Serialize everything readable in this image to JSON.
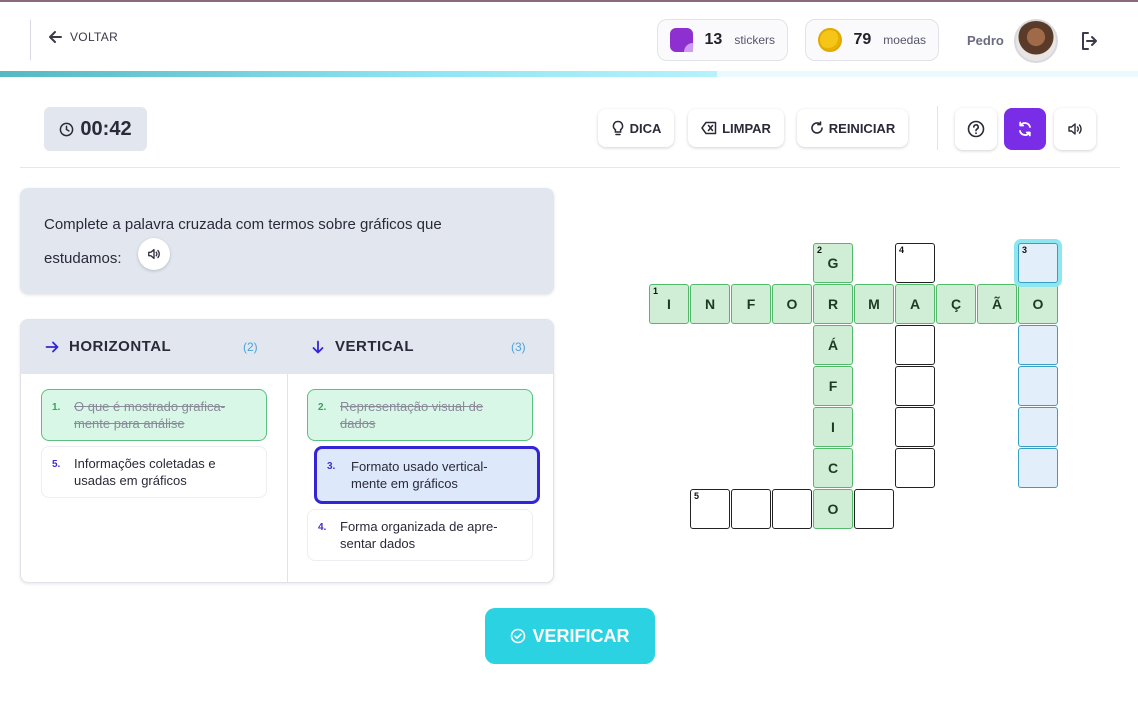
{
  "header": {
    "back_label": "VOLTAR",
    "stickers": {
      "count": "13",
      "label": "stickers"
    },
    "coins": {
      "count": "79",
      "label": "moedas"
    },
    "user_name": "Pedro",
    "progress_fraction": 0.63
  },
  "toolbar": {
    "timer": "00:42",
    "hint_label": "DICA",
    "clear_label": "LIMPAR",
    "restart_label": "REINICIAR",
    "icons": [
      "help-icon",
      "sync-icon",
      "volume-icon"
    ],
    "active_color": "#7a2de6"
  },
  "instruction": {
    "line1": "Complete a palavra cruzada com termos sobre gráficos que",
    "line2": "estudamos:"
  },
  "clues": {
    "horizontal": {
      "title": "HORIZONTAL",
      "count": "(2)",
      "items": [
        {
          "n": "1.",
          "line1": "O que é mostrado grafica-",
          "line2": "mente para análise",
          "state": "done"
        },
        {
          "n": "5.",
          "line1": "Informações coletadas e",
          "line2": "usadas em gráficos",
          "state": "plain"
        }
      ]
    },
    "vertical": {
      "title": "VERTICAL",
      "count": "(3)",
      "items": [
        {
          "n": "2.",
          "line1": "Representação visual de",
          "line2": "dados",
          "state": "done"
        },
        {
          "n": "3.",
          "line1": "Formato usado vertical-",
          "line2": "mente em gráficos",
          "state": "selected"
        },
        {
          "n": "4.",
          "line1": "Forma organizada de apre-",
          "line2": "sentar dados",
          "state": "plain"
        }
      ]
    }
  },
  "crossword": {
    "word1_horizontal": [
      "I",
      "N",
      "F",
      "O",
      "R",
      "M",
      "A",
      "Ç",
      "Ã",
      "O"
    ],
    "word2_vertical": [
      "G",
      "R",
      "Á",
      "F",
      "I",
      "C",
      "O"
    ],
    "numbers": {
      "n1": "1",
      "n2": "2",
      "n3": "3",
      "n4": "4",
      "n5": "5"
    },
    "colors": {
      "solved": "#cfeed5",
      "active": "#e2effb"
    }
  },
  "verify_label": "VERIFICAR"
}
